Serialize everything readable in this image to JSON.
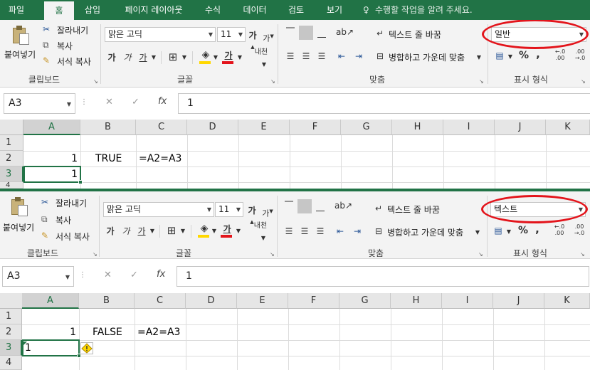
{
  "tabs": [
    "파일",
    "홈",
    "삽입",
    "페이지 레이아웃",
    "수식",
    "데이터",
    "검토",
    "보기"
  ],
  "tell_me": "수행할 작업을 알려 주세요.",
  "clipboard": {
    "paste": "붙여넣기",
    "cut": "잘라내기",
    "copy": "복사",
    "format_painter": "서식 복사",
    "group": "클립보드"
  },
  "font": {
    "name": "맑은 고딕",
    "size": "11",
    "bold": "가",
    "italic": "가",
    "underline": "가",
    "font_color": "가",
    "phonetic": "내천",
    "group": "글꼴"
  },
  "alignment": {
    "wrap": "텍스트 줄 바꿈",
    "merge": "병합하고 가운데 맞춤",
    "group": "맞춤"
  },
  "number": {
    "group": "표시 형식",
    "percent": "%",
    "comma": ",",
    "inc_decimal": "←.0\n.00",
    "dec_decimal": ".00\n→.0"
  },
  "grid": {
    "columns": [
      "A",
      "B",
      "C",
      "D",
      "E",
      "F",
      "G",
      "H",
      "I",
      "J",
      "K"
    ],
    "rows": [
      "1",
      "2",
      "3",
      "4"
    ]
  },
  "panels": [
    {
      "format": "일반",
      "namebox": "A3",
      "formula": "1",
      "cells": {
        "A2": "1",
        "B2": "TRUE",
        "C2": "=A2=A3",
        "A3": "1"
      }
    },
    {
      "format": "텍스트",
      "namebox": "A3",
      "formula": "1",
      "cells": {
        "A2": "1",
        "B2": "FALSE",
        "C2": "=A2=A3",
        "A3": "1"
      }
    }
  ],
  "colors": {
    "accent": "#217346",
    "highlight": "#e3141b",
    "fill_yellow": "#ffd800",
    "font_red": "#e3141b"
  }
}
